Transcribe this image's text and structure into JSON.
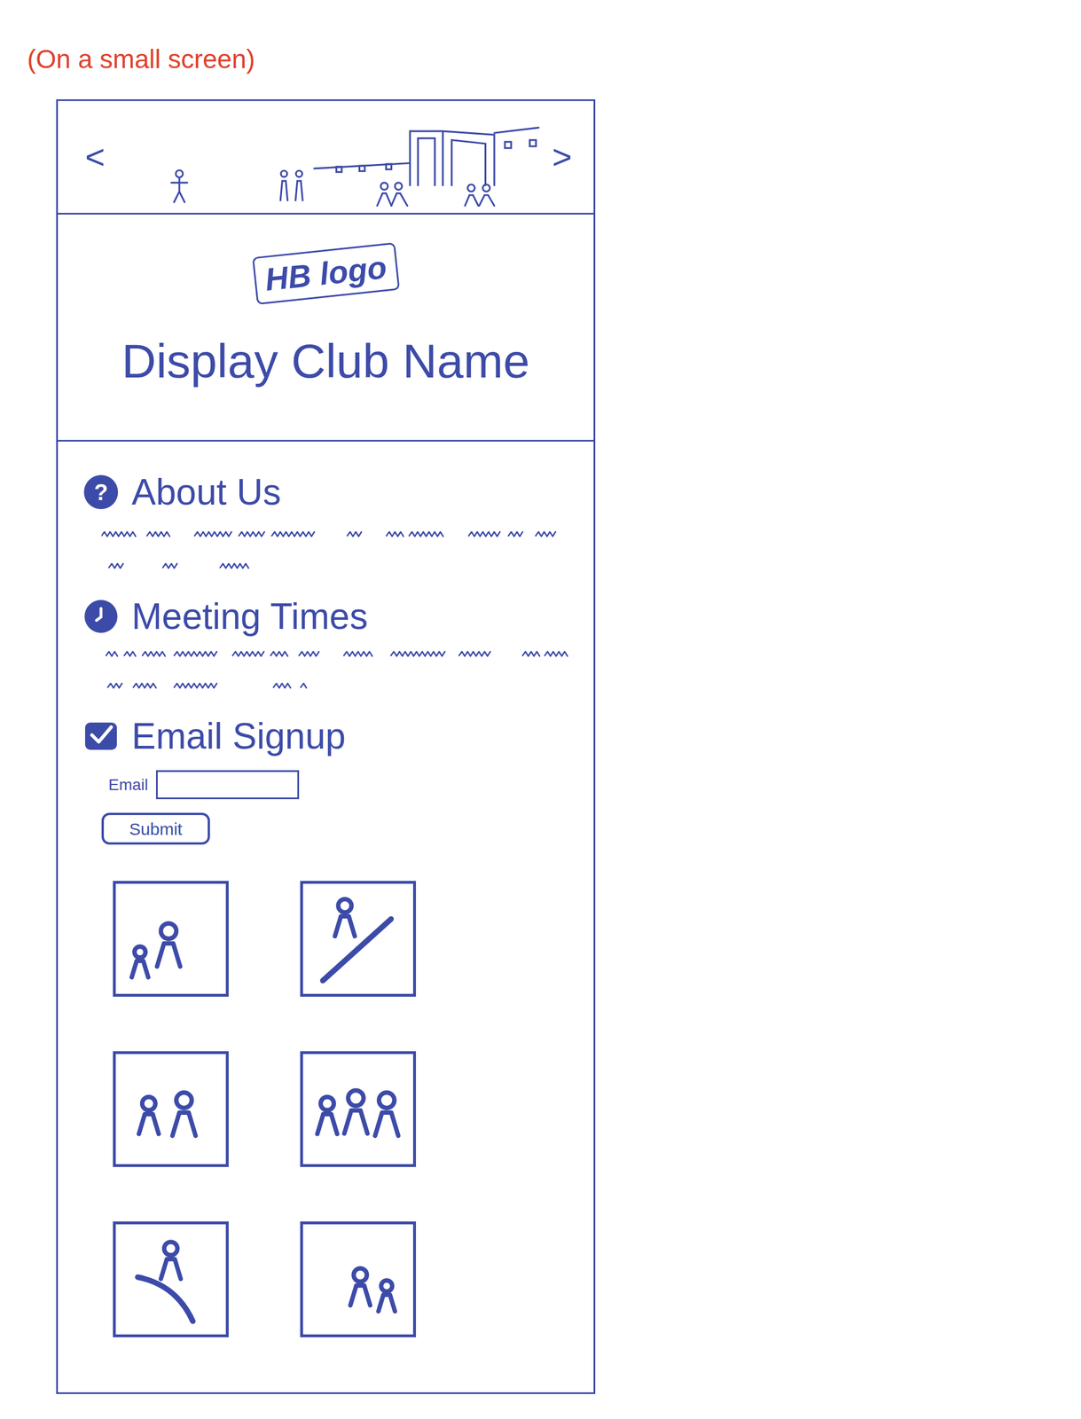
{
  "note": "(On a small screen)",
  "carousel": {
    "prev": "<",
    "next": ">"
  },
  "logo": "HB logo",
  "club_name": "Display Club Name",
  "sections": [
    {
      "title": "About Us",
      "kind": "text",
      "icon": "?"
    },
    {
      "title": "Meeting Times",
      "kind": "text",
      "icon": ""
    },
    {
      "title": "Email Signup",
      "kind": "form",
      "icon": ""
    }
  ],
  "form": {
    "label": "Email",
    "button": "Submit"
  }
}
